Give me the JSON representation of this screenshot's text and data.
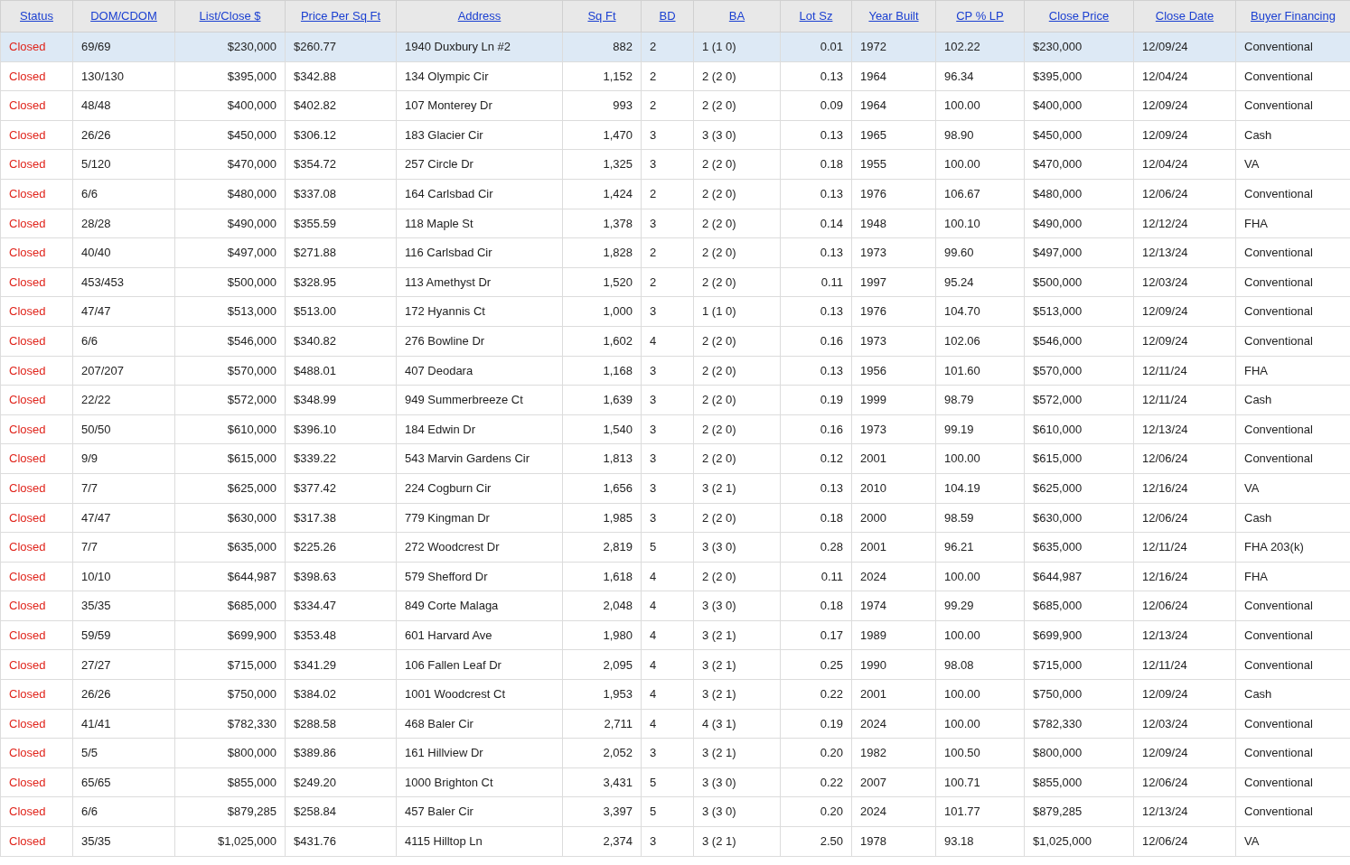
{
  "table": {
    "columns": [
      "Status",
      "DOM/CDOM",
      "List/Close $",
      "Price Per Sq Ft",
      "Address",
      "Sq Ft",
      "BD",
      "BA",
      "Lot Sz",
      "Year Built",
      "CP % LP",
      "Close Price",
      "Close Date",
      "Buyer Financing"
    ],
    "rows": [
      {
        "selected": true,
        "cells": [
          "Closed",
          "69/69",
          "$230,000",
          "$260.77",
          "1940 Duxbury Ln #2",
          "882",
          "2",
          "1 (1 0)",
          "0.01",
          "1972",
          "102.22",
          "$230,000",
          "12/09/24",
          "Conventional"
        ]
      },
      {
        "selected": false,
        "cells": [
          "Closed",
          "130/130",
          "$395,000",
          "$342.88",
          "134 Olympic Cir",
          "1,152",
          "2",
          "2 (2 0)",
          "0.13",
          "1964",
          "96.34",
          "$395,000",
          "12/04/24",
          "Conventional"
        ]
      },
      {
        "selected": false,
        "cells": [
          "Closed",
          "48/48",
          "$400,000",
          "$402.82",
          "107 Monterey Dr",
          "993",
          "2",
          "2 (2 0)",
          "0.09",
          "1964",
          "100.00",
          "$400,000",
          "12/09/24",
          "Conventional"
        ]
      },
      {
        "selected": false,
        "cells": [
          "Closed",
          "26/26",
          "$450,000",
          "$306.12",
          "183 Glacier Cir",
          "1,470",
          "3",
          "3 (3 0)",
          "0.13",
          "1965",
          "98.90",
          "$450,000",
          "12/09/24",
          "Cash"
        ]
      },
      {
        "selected": false,
        "cells": [
          "Closed",
          "5/120",
          "$470,000",
          "$354.72",
          "257 Circle Dr",
          "1,325",
          "3",
          "2 (2 0)",
          "0.18",
          "1955",
          "100.00",
          "$470,000",
          "12/04/24",
          "VA"
        ]
      },
      {
        "selected": false,
        "cells": [
          "Closed",
          "6/6",
          "$480,000",
          "$337.08",
          "164 Carlsbad Cir",
          "1,424",
          "2",
          "2 (2 0)",
          "0.13",
          "1976",
          "106.67",
          "$480,000",
          "12/06/24",
          "Conventional"
        ]
      },
      {
        "selected": false,
        "cells": [
          "Closed",
          "28/28",
          "$490,000",
          "$355.59",
          "118 Maple St",
          "1,378",
          "3",
          "2 (2 0)",
          "0.14",
          "1948",
          "100.10",
          "$490,000",
          "12/12/24",
          "FHA"
        ]
      },
      {
        "selected": false,
        "cells": [
          "Closed",
          "40/40",
          "$497,000",
          "$271.88",
          "116 Carlsbad Cir",
          "1,828",
          "2",
          "2 (2 0)",
          "0.13",
          "1973",
          "99.60",
          "$497,000",
          "12/13/24",
          "Conventional"
        ]
      },
      {
        "selected": false,
        "cells": [
          "Closed",
          "453/453",
          "$500,000",
          "$328.95",
          "113 Amethyst Dr",
          "1,520",
          "2",
          "2 (2 0)",
          "0.11",
          "1997",
          "95.24",
          "$500,000",
          "12/03/24",
          "Conventional"
        ]
      },
      {
        "selected": false,
        "cells": [
          "Closed",
          "47/47",
          "$513,000",
          "$513.00",
          "172 Hyannis Ct",
          "1,000",
          "3",
          "1 (1 0)",
          "0.13",
          "1976",
          "104.70",
          "$513,000",
          "12/09/24",
          "Conventional"
        ]
      },
      {
        "selected": false,
        "cells": [
          "Closed",
          "6/6",
          "$546,000",
          "$340.82",
          "276 Bowline Dr",
          "1,602",
          "4",
          "2 (2 0)",
          "0.16",
          "1973",
          "102.06",
          "$546,000",
          "12/09/24",
          "Conventional"
        ]
      },
      {
        "selected": false,
        "cells": [
          "Closed",
          "207/207",
          "$570,000",
          "$488.01",
          "407 Deodara",
          "1,168",
          "3",
          "2 (2 0)",
          "0.13",
          "1956",
          "101.60",
          "$570,000",
          "12/11/24",
          "FHA"
        ]
      },
      {
        "selected": false,
        "cells": [
          "Closed",
          "22/22",
          "$572,000",
          "$348.99",
          "949 Summerbreeze Ct",
          "1,639",
          "3",
          "2 (2 0)",
          "0.19",
          "1999",
          "98.79",
          "$572,000",
          "12/11/24",
          "Cash"
        ]
      },
      {
        "selected": false,
        "cells": [
          "Closed",
          "50/50",
          "$610,000",
          "$396.10",
          "184 Edwin Dr",
          "1,540",
          "3",
          "2 (2 0)",
          "0.16",
          "1973",
          "99.19",
          "$610,000",
          "12/13/24",
          "Conventional"
        ]
      },
      {
        "selected": false,
        "cells": [
          "Closed",
          "9/9",
          "$615,000",
          "$339.22",
          "543 Marvin Gardens Cir",
          "1,813",
          "3",
          "2 (2 0)",
          "0.12",
          "2001",
          "100.00",
          "$615,000",
          "12/06/24",
          "Conventional"
        ]
      },
      {
        "selected": false,
        "cells": [
          "Closed",
          "7/7",
          "$625,000",
          "$377.42",
          "224 Cogburn Cir",
          "1,656",
          "3",
          "3 (2 1)",
          "0.13",
          "2010",
          "104.19",
          "$625,000",
          "12/16/24",
          "VA"
        ]
      },
      {
        "selected": false,
        "cells": [
          "Closed",
          "47/47",
          "$630,000",
          "$317.38",
          "779 Kingman Dr",
          "1,985",
          "3",
          "2 (2 0)",
          "0.18",
          "2000",
          "98.59",
          "$630,000",
          "12/06/24",
          "Cash"
        ]
      },
      {
        "selected": false,
        "cells": [
          "Closed",
          "7/7",
          "$635,000",
          "$225.26",
          "272 Woodcrest Dr",
          "2,819",
          "5",
          "3 (3 0)",
          "0.28",
          "2001",
          "96.21",
          "$635,000",
          "12/11/24",
          "FHA 203(k)"
        ]
      },
      {
        "selected": false,
        "cells": [
          "Closed",
          "10/10",
          "$644,987",
          "$398.63",
          "579 Shefford Dr",
          "1,618",
          "4",
          "2 (2 0)",
          "0.11",
          "2024",
          "100.00",
          "$644,987",
          "12/16/24",
          "FHA"
        ]
      },
      {
        "selected": false,
        "cells": [
          "Closed",
          "35/35",
          "$685,000",
          "$334.47",
          "849 Corte Malaga",
          "2,048",
          "4",
          "3 (3 0)",
          "0.18",
          "1974",
          "99.29",
          "$685,000",
          "12/06/24",
          "Conventional"
        ]
      },
      {
        "selected": false,
        "cells": [
          "Closed",
          "59/59",
          "$699,900",
          "$353.48",
          "601 Harvard Ave",
          "1,980",
          "4",
          "3 (2 1)",
          "0.17",
          "1989",
          "100.00",
          "$699,900",
          "12/13/24",
          "Conventional"
        ]
      },
      {
        "selected": false,
        "cells": [
          "Closed",
          "27/27",
          "$715,000",
          "$341.29",
          "106 Fallen Leaf Dr",
          "2,095",
          "4",
          "3 (2 1)",
          "0.25",
          "1990",
          "98.08",
          "$715,000",
          "12/11/24",
          "Conventional"
        ]
      },
      {
        "selected": false,
        "cells": [
          "Closed",
          "26/26",
          "$750,000",
          "$384.02",
          "1001 Woodcrest Ct",
          "1,953",
          "4",
          "3 (2 1)",
          "0.22",
          "2001",
          "100.00",
          "$750,000",
          "12/09/24",
          "Cash"
        ]
      },
      {
        "selected": false,
        "cells": [
          "Closed",
          "41/41",
          "$782,330",
          "$288.58",
          "468 Baler Cir",
          "2,711",
          "4",
          "4 (3 1)",
          "0.19",
          "2024",
          "100.00",
          "$782,330",
          "12/03/24",
          "Conventional"
        ]
      },
      {
        "selected": false,
        "cells": [
          "Closed",
          "5/5",
          "$800,000",
          "$389.86",
          "161 Hillview Dr",
          "2,052",
          "3",
          "3 (2 1)",
          "0.20",
          "1982",
          "100.50",
          "$800,000",
          "12/09/24",
          "Conventional"
        ]
      },
      {
        "selected": false,
        "cells": [
          "Closed",
          "65/65",
          "$855,000",
          "$249.20",
          "1000 Brighton Ct",
          "3,431",
          "5",
          "3 (3 0)",
          "0.22",
          "2007",
          "100.71",
          "$855,000",
          "12/06/24",
          "Conventional"
        ]
      },
      {
        "selected": false,
        "cells": [
          "Closed",
          "6/6",
          "$879,285",
          "$258.84",
          "457 Baler Cir",
          "3,397",
          "5",
          "3 (3 0)",
          "0.20",
          "2024",
          "101.77",
          "$879,285",
          "12/13/24",
          "Conventional"
        ]
      },
      {
        "selected": false,
        "cells": [
          "Closed",
          "35/35",
          "$1,025,000",
          "$431.76",
          "4115 Hilltop Ln",
          "2,374",
          "3",
          "3 (2 1)",
          "2.50",
          "1978",
          "93.18",
          "$1,025,000",
          "12/06/24",
          "VA"
        ]
      }
    ]
  }
}
